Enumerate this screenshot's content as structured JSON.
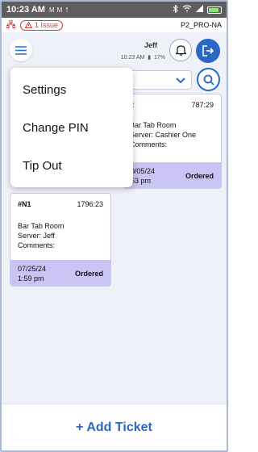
{
  "status_bar": {
    "time": "10:23 AM",
    "notif_icons": [
      "M",
      "M",
      "↑"
    ],
    "right_icons": [
      "bluetooth-icon",
      "wifi-icon",
      "signal-icon"
    ]
  },
  "issue_bar": {
    "issue_label": "1 Issue",
    "device_label": "P2_PRO-NA"
  },
  "header": {
    "user_name": "Jeff",
    "time": "10:23 AM",
    "battery": "17%"
  },
  "menu": {
    "items": [
      {
        "label": "Settings"
      },
      {
        "label": "Change PIN"
      },
      {
        "label": "Tip Out"
      }
    ]
  },
  "tickets": [
    {
      "id": "2",
      "number": "787:29",
      "room": "Bar Tab Room",
      "server": "Server: Cashier One",
      "comments": "Comments:",
      "date": "0/05/24",
      "time": "53 pm",
      "status": "Ordered"
    },
    {
      "id": "#N1",
      "number": "1796:23",
      "room": "Bar Tab Room",
      "server": "Server: Jeff",
      "comments": "Comments:",
      "date": "07/25/24",
      "time": "1:59 pm",
      "status": "Ordered"
    }
  ],
  "footer": {
    "add_ticket_label": "+ Add Ticket"
  },
  "colors": {
    "accent": "#2a68c5",
    "card_footer": "#c9c4f4",
    "issue_red": "#d33"
  }
}
